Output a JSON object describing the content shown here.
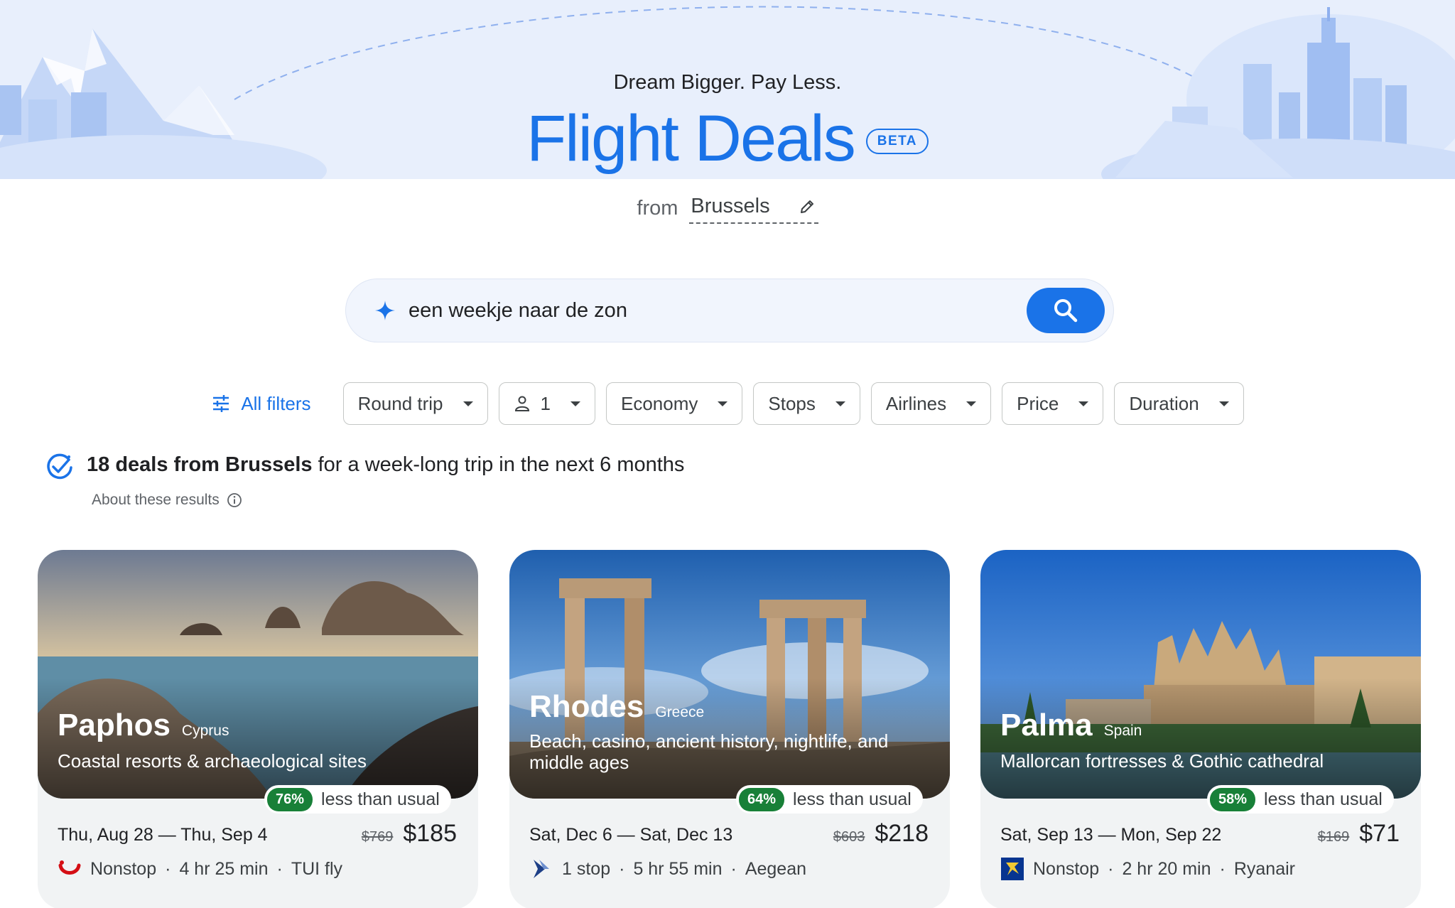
{
  "hero": {
    "tagline": "Dream Bigger. Pay Less.",
    "title": "Flight Deals",
    "beta": "BETA",
    "from_label": "from",
    "from_city": "Brussels"
  },
  "search": {
    "value": "een weekje naar de zon",
    "icon": "sparkle-icon",
    "button_icon": "search-icon"
  },
  "filters": {
    "all_filters": "All filters",
    "chips": [
      "Round trip",
      "1",
      "Economy",
      "Stops",
      "Airlines",
      "Price",
      "Duration"
    ]
  },
  "results": {
    "count_text": "18 deals from Brussels",
    "rest_text": " for a week-long trip in the next 6 months",
    "about": "About these results"
  },
  "cards": [
    {
      "city": "Paphos",
      "country": "Cyprus",
      "description": "Coastal resorts & archaeological sites",
      "percent": "76%",
      "less_text": "less than usual",
      "dates": "Thu, Aug 28 — Thu, Sep 4",
      "old_price": "$769",
      "price": "$185",
      "stops": "Nonstop",
      "duration": "4 hr 25 min",
      "airline": "TUI fly",
      "airline_icon": "tui-logo-icon"
    },
    {
      "city": "Rhodes",
      "country": "Greece",
      "description": "Beach, casino, ancient history, nightlife, and middle ages",
      "percent": "64%",
      "less_text": "less than usual",
      "dates": "Sat, Dec 6 — Sat, Dec 13",
      "old_price": "$603",
      "price": "$218",
      "stops": "1 stop",
      "duration": "5 hr 55 min",
      "airline": "Aegean",
      "airline_icon": "aegean-logo-icon"
    },
    {
      "city": "Palma",
      "country": "Spain",
      "description": "Mallorcan fortresses & Gothic cathedral",
      "percent": "58%",
      "less_text": "less than usual",
      "dates": "Sat, Sep 13 — Mon, Sep 22",
      "old_price": "$169",
      "price": "$71",
      "stops": "Nonstop",
      "duration": "2 hr 20 min",
      "airline": "Ryanair",
      "airline_icon": "ryanair-logo-icon"
    }
  ],
  "colors": {
    "accent": "#1a73e8",
    "hero_bg": "#e8effc",
    "deal_green": "#188038"
  }
}
